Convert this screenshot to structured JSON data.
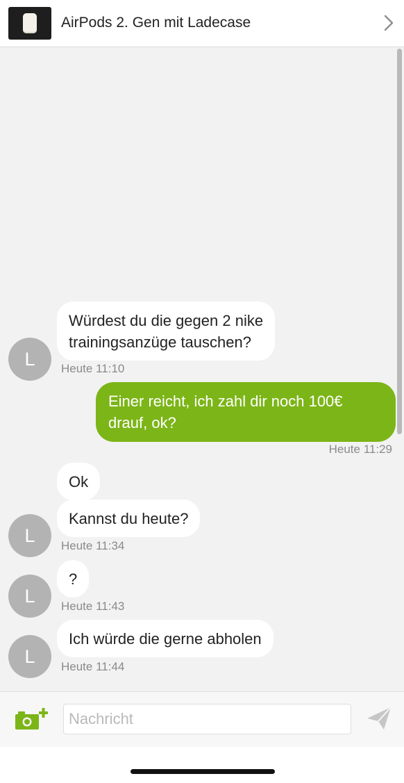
{
  "header": {
    "title": "AirPods 2. Gen mit Ladecase",
    "thumbnail_icon": "airpods-case-icon",
    "chevron_icon": "chevron-right-icon"
  },
  "messages": [
    {
      "direction": "incoming",
      "avatar": "L",
      "lines": [
        "Würdest du die gegen 2 nike",
        "trainingsanzüge tauschen?"
      ],
      "time": "Heute 11:10"
    },
    {
      "direction": "outgoing",
      "lines": [
        "Einer reicht, ich zahl dir noch 100€",
        "drauf, ok?"
      ],
      "time": "Heute 11:29"
    },
    {
      "direction": "incoming",
      "lines": [
        "Ok"
      ]
    },
    {
      "direction": "incoming",
      "avatar": "L",
      "lines": [
        "Kannst du heute?"
      ],
      "time": "Heute 11:34"
    },
    {
      "direction": "incoming",
      "avatar": "L",
      "lines": [
        "?"
      ],
      "time": "Heute 11:43"
    },
    {
      "direction": "incoming",
      "avatar": "L",
      "lines": [
        "Ich würde die gerne abholen"
      ],
      "time": "Heute 11:44"
    }
  ],
  "input": {
    "placeholder": "Nachricht",
    "value": "",
    "camera_icon": "camera-add-icon",
    "send_icon": "send-icon"
  },
  "colors": {
    "accent": "#7cb518",
    "background": "#f2f2f2",
    "avatar": "#b3b3b3"
  }
}
